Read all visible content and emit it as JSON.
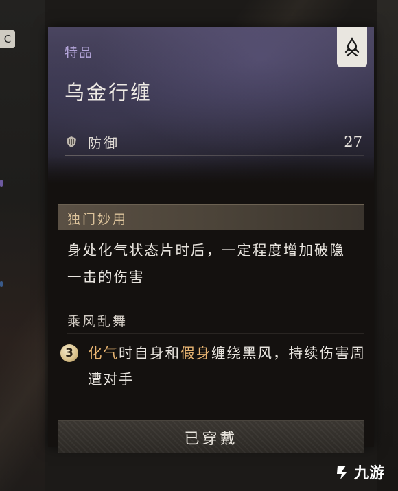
{
  "side": {
    "key_hint": "C"
  },
  "item": {
    "grade": "特品",
    "name": "乌金行缠",
    "emblem_icon": "flame-emblem-icon",
    "stats": [
      {
        "icon": "shield-icon",
        "label": "防御",
        "value": "27"
      }
    ]
  },
  "unique_effect": {
    "title": "独门妙用",
    "text": "身处化气状态片时后，一定程度增加破隐一击的伤害"
  },
  "set_bonus": {
    "name": "乘风乱舞",
    "tier": "3",
    "text_parts": [
      {
        "text": "化气",
        "highlight": true
      },
      {
        "text": "时自身和",
        "highlight": false
      },
      {
        "text": "假身",
        "highlight": true
      },
      {
        "text": "缠绕黑风，持续伤害周遭对手",
        "highlight": false
      }
    ]
  },
  "equip_status": "已穿戴",
  "watermark": {
    "text": "九游"
  },
  "colors": {
    "grade_purple": "#b6a7dc",
    "highlight_gold": "#e6b371",
    "section_title": "#dcc39b"
  }
}
